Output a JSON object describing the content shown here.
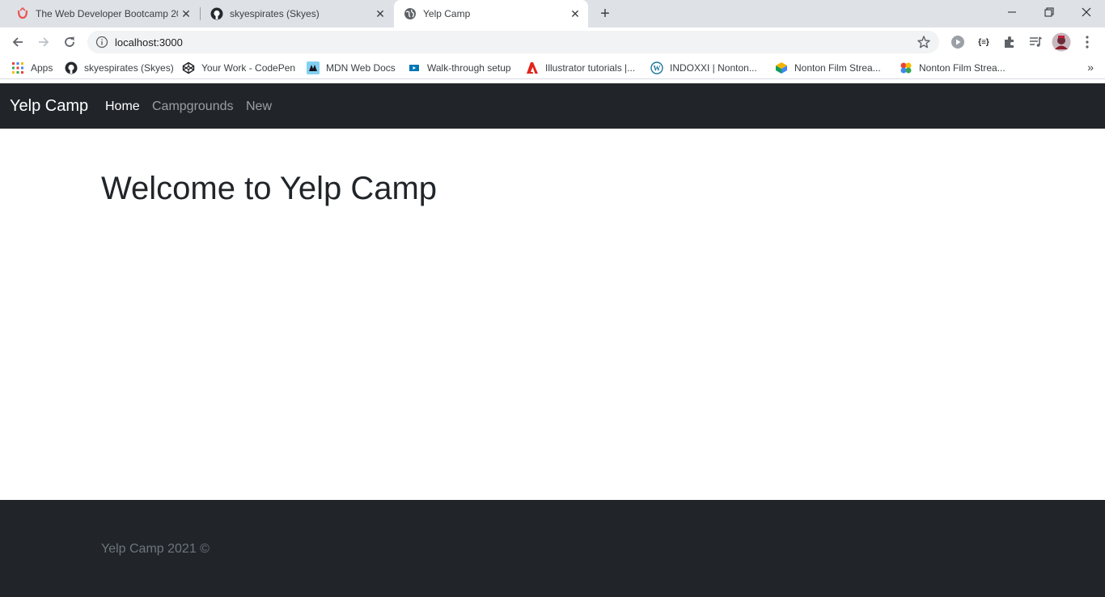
{
  "browser": {
    "tabs": [
      {
        "title": "The Web Developer Bootcamp 20",
        "icon": "udemy-icon",
        "active": false
      },
      {
        "title": "skyespirates (Skyes)",
        "icon": "github-icon",
        "active": false
      },
      {
        "title": "Yelp Camp",
        "icon": "globe-icon",
        "active": true
      }
    ],
    "new_tab": "+",
    "url": "localhost:3000",
    "bookmarks": [
      {
        "label": "Apps",
        "icon": "apps-grid-icon"
      },
      {
        "label": "skyespirates (Skyes)",
        "icon": "github-icon"
      },
      {
        "label": "Your Work - CodePen",
        "icon": "codepen-icon"
      },
      {
        "label": "MDN Web Docs",
        "icon": "mdn-icon"
      },
      {
        "label": "Walk-through setup",
        "icon": "video-icon"
      },
      {
        "label": "Illustrator tutorials |...",
        "icon": "adobe-icon"
      },
      {
        "label": "INDOXXI | Nonton...",
        "icon": "wordpress-icon"
      },
      {
        "label": "Nonton Film Strea...",
        "icon": "cube-icon"
      },
      {
        "label": "Nonton Film Strea...",
        "icon": "pinwheel-icon"
      }
    ],
    "bookmarks_overflow": "»"
  },
  "site": {
    "brand": "Yelp Camp",
    "nav": [
      {
        "label": "Home",
        "active": true
      },
      {
        "label": "Campgrounds",
        "active": false
      },
      {
        "label": "New",
        "active": false
      }
    ],
    "heading": "Welcome to Yelp Camp",
    "footer": "Yelp Camp 2021 ©"
  },
  "colors": {
    "navbar_bg": "#212529",
    "footer_text": "#6c757d",
    "chrome_bg": "#dee1e6"
  }
}
